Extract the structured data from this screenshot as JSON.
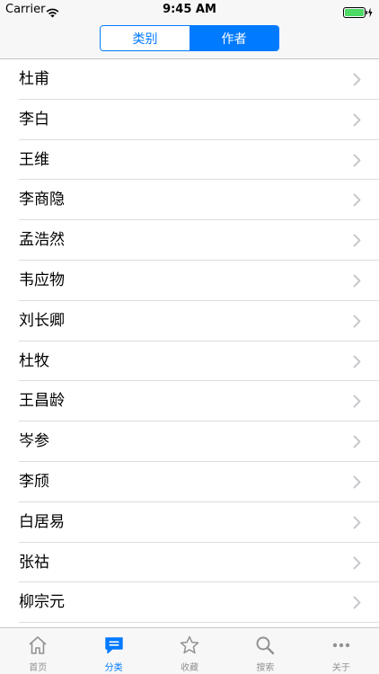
{
  "status": {
    "carrier": "Carrier",
    "time": "9:45 AM"
  },
  "segmented": {
    "items": [
      {
        "label": "类别"
      },
      {
        "label": "作者"
      }
    ],
    "selected": 1
  },
  "authors": [
    {
      "name": "杜甫"
    },
    {
      "name": "李白"
    },
    {
      "name": "王维"
    },
    {
      "name": "李商隐"
    },
    {
      "name": "孟浩然"
    },
    {
      "name": "韦应物"
    },
    {
      "name": "刘长卿"
    },
    {
      "name": "杜牧"
    },
    {
      "name": "王昌龄"
    },
    {
      "name": "岑参"
    },
    {
      "name": "李颀"
    },
    {
      "name": "白居易"
    },
    {
      "name": "张祜"
    },
    {
      "name": "柳宗元"
    },
    {
      "name": ""
    }
  ],
  "tabs": [
    {
      "label": "首页",
      "icon": "home-icon"
    },
    {
      "label": "分类",
      "icon": "chat-bubble-icon",
      "active": true
    },
    {
      "label": "收藏",
      "icon": "star-icon"
    },
    {
      "label": "搜索",
      "icon": "search-icon"
    },
    {
      "label": "关于",
      "icon": "more-icon"
    }
  ],
  "colors": {
    "accent": "#007aff",
    "inactive": "#929292",
    "bar_bg": "#f7f7f7",
    "separator": "#dcdce0",
    "chevron": "#c7c7cc"
  }
}
